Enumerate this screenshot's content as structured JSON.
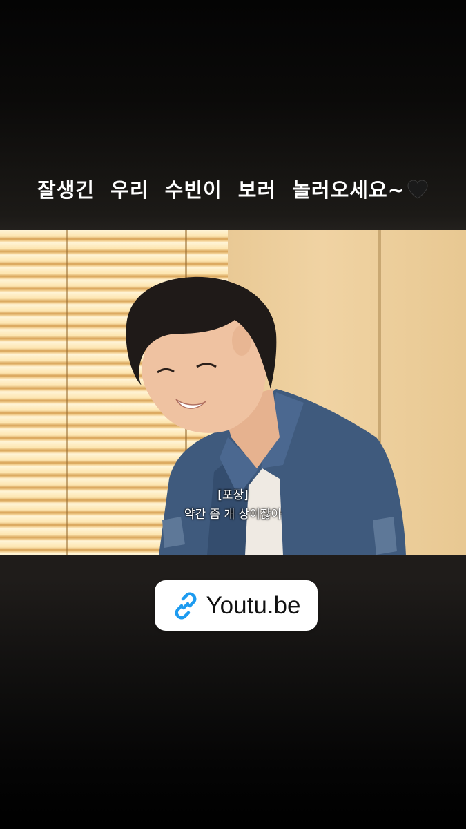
{
  "story": {
    "caption": "잘생긴 우리 수빈이 보러 놀러오세요~",
    "caption_emoji": "black-heart-icon"
  },
  "video": {
    "subtitle_line1": "[포장]",
    "subtitle_line2": "약간 좀 개 상이잖아"
  },
  "link_sticker": {
    "icon": "link-icon",
    "label": "Youtu.be",
    "icon_color": "#1d9bf0"
  }
}
